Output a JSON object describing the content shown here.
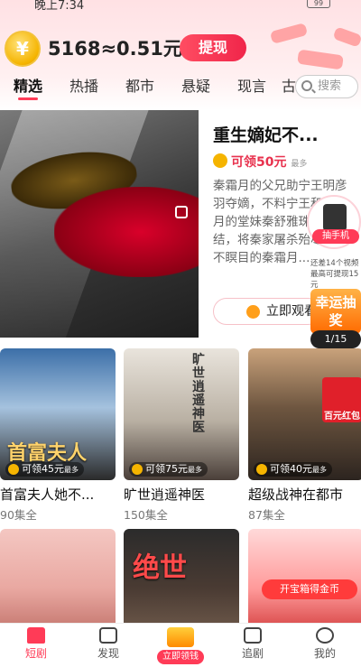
{
  "status_bar": {
    "time": "晚上7:34",
    "battery": "99"
  },
  "wallet": {
    "coin_symbol": "¥",
    "balance": "5168≈0.51元",
    "withdraw_label": "提现"
  },
  "tabs": [
    "精选",
    "热播",
    "都市",
    "悬疑",
    "现言",
    "古"
  ],
  "search": {
    "placeholder": "搜索"
  },
  "featured": {
    "title": "重生嫡妃不...",
    "reward": "可领50元",
    "reward_suffix": "最多",
    "description": "秦霜月的父兄助宁王明彦羽夺嫡，不料宁王和秦霜月的堂妹秦舒雅珠胎暗结，将秦家屠杀殆尽，死不瞑目的秦霜月...",
    "watch_label": "立即观看"
  },
  "side_ads": {
    "phone_label": "抽手机",
    "lucky_note": "还差14个视频最高可提现15元",
    "lucky_label": "幸运抽奖",
    "lucky_count": "1/15"
  },
  "cards": [
    {
      "title": "首富夫人她不...",
      "episodes": "90集全",
      "reward": "可领45元",
      "reward_suffix": "最多",
      "overlay": "首富夫人"
    },
    {
      "title": "旷世逍遥神医",
      "episodes": "150集全",
      "reward": "可领75元",
      "reward_suffix": "最多",
      "overlay": "旷世逍遥神医"
    },
    {
      "title": "超级战神在都市",
      "episodes": "87集全",
      "reward": "可领40元",
      "reward_suffix": "最多",
      "overlay": "百元红包"
    }
  ],
  "bottom_cards": [
    {
      "overlay": ""
    },
    {
      "overlay": "绝世"
    },
    {
      "overlay": "开宝箱得金币"
    }
  ],
  "nav": [
    {
      "label": "短剧",
      "icon": "home-icon"
    },
    {
      "label": "发现",
      "icon": "play-icon"
    },
    {
      "label": "立即领钱",
      "icon": "red-envelope-icon"
    },
    {
      "label": "追剧",
      "icon": "bookmark-icon"
    },
    {
      "label": "我的",
      "icon": "profile-icon"
    }
  ],
  "colors": {
    "accent": "#ff3b57",
    "coin": "#f5b400"
  }
}
